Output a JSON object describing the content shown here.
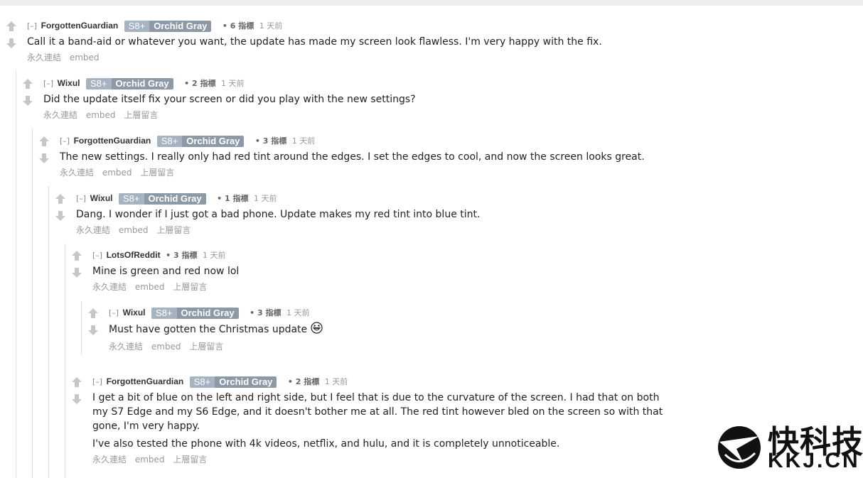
{
  "labels": {
    "collapse": "[–]",
    "permalink": "永久連結",
    "embed": "embed",
    "parent": "上層留言",
    "flair_model": "S8+",
    "flair_color": "Orchid Gray",
    "points_suffix": "指標",
    "time": "1 天前"
  },
  "comments": [
    {
      "author": "ForgottenGuardian",
      "score": "• 6",
      "lines": [
        "Call it a band-aid or whatever you want, the update has made my screen look flawless. I'm very happy with the fix."
      ]
    },
    {
      "author": "Wixul",
      "score": "• 2",
      "lines": [
        "Did the update itself fix your screen or did you play with the new settings?"
      ]
    },
    {
      "author": "ForgottenGuardian",
      "score": "• 3",
      "lines": [
        "The new settings. I really only had red tint around the edges. I set the edges to cool, and now the screen looks great."
      ]
    },
    {
      "author": "Wixul",
      "score": "• 1",
      "lines": [
        "Dang. I wonder if I just got a bad phone. Update makes my red tint into blue tint."
      ]
    },
    {
      "author": "LotsOfReddit",
      "score": "• 3",
      "lines": [
        "Mine is green and red now lol"
      ]
    },
    {
      "author": "Wixul",
      "score": "• 3",
      "lines": [
        "Must have gotten the Christmas update"
      ],
      "emoji": "laughing-emoji"
    },
    {
      "author": "ForgottenGuardian",
      "score": "• 2",
      "lines": [
        "I get a bit of blue on the left and right side, but I feel that is due to the curvature of the screen. I had that on both my S7 Edge and my S6 Edge, and it doesn't bother me at all. The red tint however bled on the screen so with that gone, I'm very happy.",
        "I've also tested the phone with 4k videos, netflix, and hulu, and it is completely unnoticeable."
      ]
    }
  ],
  "watermark": {
    "icon": "kkj-swallow-logo",
    "cn": "快科技",
    "en": "KKJ.CN"
  }
}
